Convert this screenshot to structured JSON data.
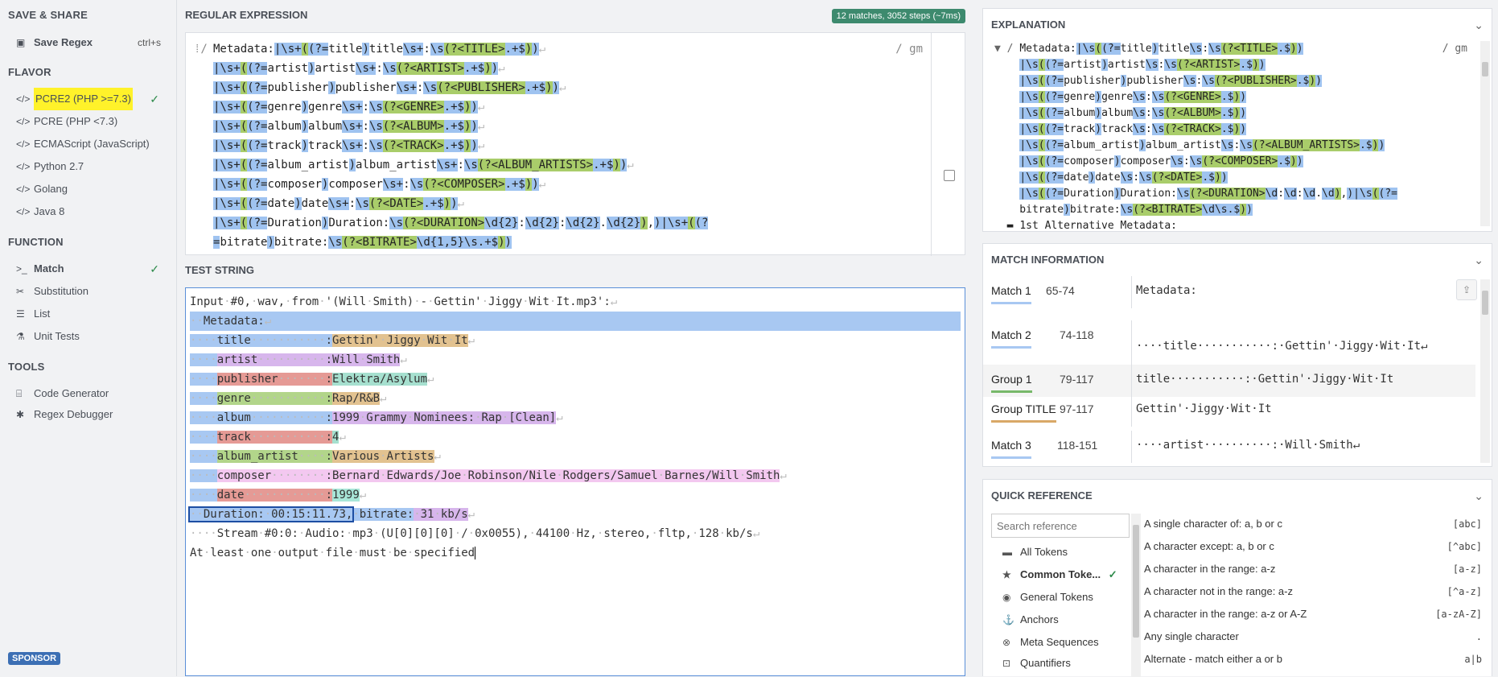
{
  "sidebar": {
    "save_share_heading": "SAVE & SHARE",
    "save_regex": "Save Regex",
    "save_shortcut": "ctrl+s",
    "flavor_heading": "FLAVOR",
    "flavors": [
      "PCRE2 (PHP >=7.3)",
      "PCRE (PHP <7.3)",
      "ECMAScript (JavaScript)",
      "Python 2.7",
      "Golang",
      "Java 8"
    ],
    "function_heading": "FUNCTION",
    "functions": [
      "Match",
      "Substitution",
      "List",
      "Unit Tests"
    ],
    "tools_heading": "TOOLS",
    "tools": [
      "Code Generator",
      "Regex Debugger"
    ],
    "sponsor": "SPONSOR"
  },
  "regex": {
    "heading": "REGULAR EXPRESSION",
    "badge": "12 matches, 3052 steps (~7ms)",
    "delimiter": "/",
    "flags": "/ gm"
  },
  "test": {
    "heading": "TEST STRING"
  },
  "explanation": {
    "heading": "EXPLANATION",
    "flags": "/ gm",
    "alt_label": "1st Alternative Metadata:"
  },
  "match_info": {
    "heading": "MATCH INFORMATION",
    "rows": [
      {
        "label": "Match 1",
        "range": "65-74",
        "text": "Metadata:",
        "color": "#a8c8f2"
      },
      {
        "label": "Match 2",
        "range": "74-118",
        "text": "····title···········:·Gettin'·Jiggy·Wit·It↵",
        "color": "#a8c8f2"
      },
      {
        "label": "Group 1",
        "range": "79-117",
        "text": "title···········:·Gettin'·Jiggy·Wit·It",
        "color": "#77b86a"
      },
      {
        "label": "Group TITLE",
        "range": "97-117",
        "text": "Gettin'·Jiggy·Wit·It",
        "color": "#d9a867"
      },
      {
        "label": "Match 3",
        "range": "118-151",
        "text": "····artist··········:·Will·Smith↵",
        "color": "#a8c8f2"
      }
    ]
  },
  "quick_ref": {
    "heading": "QUICK REFERENCE",
    "search_placeholder": "Search reference",
    "categories": [
      "All Tokens",
      "Common Toke...",
      "General Tokens",
      "Anchors",
      "Meta Sequences",
      "Quantifiers"
    ],
    "items": [
      {
        "desc": "A single character of: a, b or c",
        "token": "[abc]"
      },
      {
        "desc": "A character except: a, b or c",
        "token": "[^abc]"
      },
      {
        "desc": "A character in the range: a-z",
        "token": "[a-z]"
      },
      {
        "desc": "A character not in the range: a-z",
        "token": "[^a-z]"
      },
      {
        "desc": "A character in the range: a-z or A-Z",
        "token": "[a-zA-Z]"
      },
      {
        "desc": "Any single character",
        "token": "."
      },
      {
        "desc": "Alternate - match either a or b",
        "token": "a|b"
      }
    ]
  }
}
